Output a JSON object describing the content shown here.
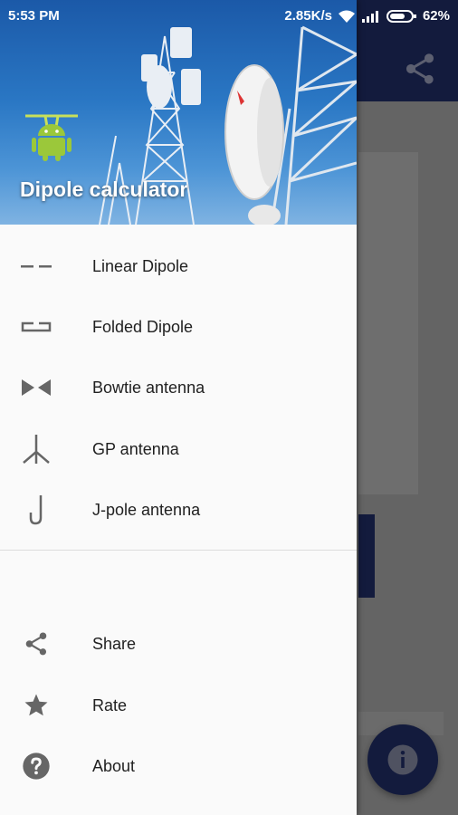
{
  "status_bar": {
    "time": "5:53 PM",
    "network_speed": "2.85K/s",
    "battery_percent": "62%"
  },
  "drawer": {
    "title": "Dipole calculator",
    "menu_primary": [
      {
        "label": "Linear Dipole",
        "icon": "linear-dipole-icon"
      },
      {
        "label": "Folded Dipole",
        "icon": "folded-dipole-icon"
      },
      {
        "label": "Bowtie antenna",
        "icon": "bowtie-antenna-icon"
      },
      {
        "label": "GP antenna",
        "icon": "gp-antenna-icon"
      },
      {
        "label": "J-pole antenna",
        "icon": "j-pole-antenna-icon"
      }
    ],
    "menu_secondary": [
      {
        "label": "Share",
        "icon": "share-icon"
      },
      {
        "label": "Rate",
        "icon": "star-icon"
      },
      {
        "label": "About",
        "icon": "help-icon"
      }
    ]
  },
  "colors": {
    "primary": "#1e2a5e",
    "icon_gray": "#666666",
    "text": "#212121"
  }
}
